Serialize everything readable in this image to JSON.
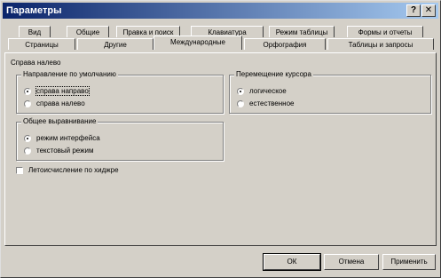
{
  "window": {
    "title": "Параметры",
    "help_glyph": "?",
    "close_glyph": "✕"
  },
  "tabs_row1": [
    "Вид",
    "Общие",
    "Правка и поиск",
    "Клавиатура",
    "Режим таблицы",
    "Формы и отчеты"
  ],
  "tabs_row2": [
    "Страницы",
    "Другие",
    "Международные",
    "Орфография",
    "Таблицы и запросы"
  ],
  "active_tab": "Международные",
  "panel": {
    "section_title": "Справа налево",
    "direction_group": {
      "legend": "Направление по умолчанию",
      "options": [
        "справа направо",
        "справа налево"
      ],
      "selected": "справа направо"
    },
    "alignment_group": {
      "legend": "Общее выравнивание",
      "options": [
        "режим интерфейса",
        "текстовый режим"
      ],
      "selected": "режим интерфейса"
    },
    "cursor_group": {
      "legend": "Перемещение курсора",
      "options": [
        "логическое",
        "естественное"
      ],
      "selected": "логическое"
    },
    "hijri_checkbox": {
      "label": "Летоисчисление по хиджре",
      "checked": false
    }
  },
  "buttons": {
    "ok": "ОК",
    "cancel": "Отмена",
    "apply": "Применить"
  }
}
